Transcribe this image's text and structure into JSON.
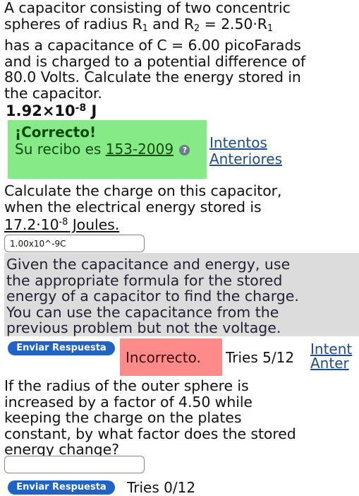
{
  "q1": {
    "line1": "A capacitor consisting of two concentric",
    "line2_a": "spheres of radius R",
    "line2_sub1": "1",
    "line2_b": " and R",
    "line2_sub2": "2",
    "line2_c": " = 2.50·R",
    "line2_sub3": "1",
    "line3": "has a capacitance of C = 6.00 picoFarads",
    "line4": "and is charged to a potential difference of",
    "line5": "80.0 Volts. Calculate the energy stored in",
    "line6": "the capacitor.",
    "answer_base": "1.92×10",
    "answer_exp": "-8",
    "answer_unit": " J"
  },
  "feedback1": {
    "title": "¡Correcto!",
    "receipt_label": "Su recibo es ",
    "receipt_link": "153-2009",
    "help_icon": "?",
    "previous_link_l1": "Intentos",
    "previous_link_l2": "Anteriores"
  },
  "q2": {
    "line1": "Calculate the charge on this capacitor,",
    "line2": "when the electrical energy stored is",
    "value_base": "17.2·10",
    "value_exp": "-8",
    "value_unit": " Joules.",
    "input_value": "1.00x10^-9C",
    "hint_l1": "Given the capacitance and energy, use",
    "hint_l2": "the appropriate formula for the stored",
    "hint_l3": "energy of a capacitor to find the charge.",
    "hint_l4": "You can use the capacitance from the",
    "hint_l5": "previous problem but not the voltage.",
    "submit_label": "Enviar Respuesta",
    "result": "Incorrecto.",
    "tries": "Tries 5/12",
    "side_link_l1": "Intent",
    "side_link_l2": "Anter"
  },
  "q3": {
    "line1": "If the radius of the outer sphere is",
    "line2": "increased by a factor of 4.50 while",
    "line3": "keeping the charge on the plates",
    "line4": "constant, by what factor does the stored",
    "line5": "energy change?",
    "input_value": "",
    "submit_label": "Enviar Respuesta",
    "tries": "Tries 0/12"
  }
}
